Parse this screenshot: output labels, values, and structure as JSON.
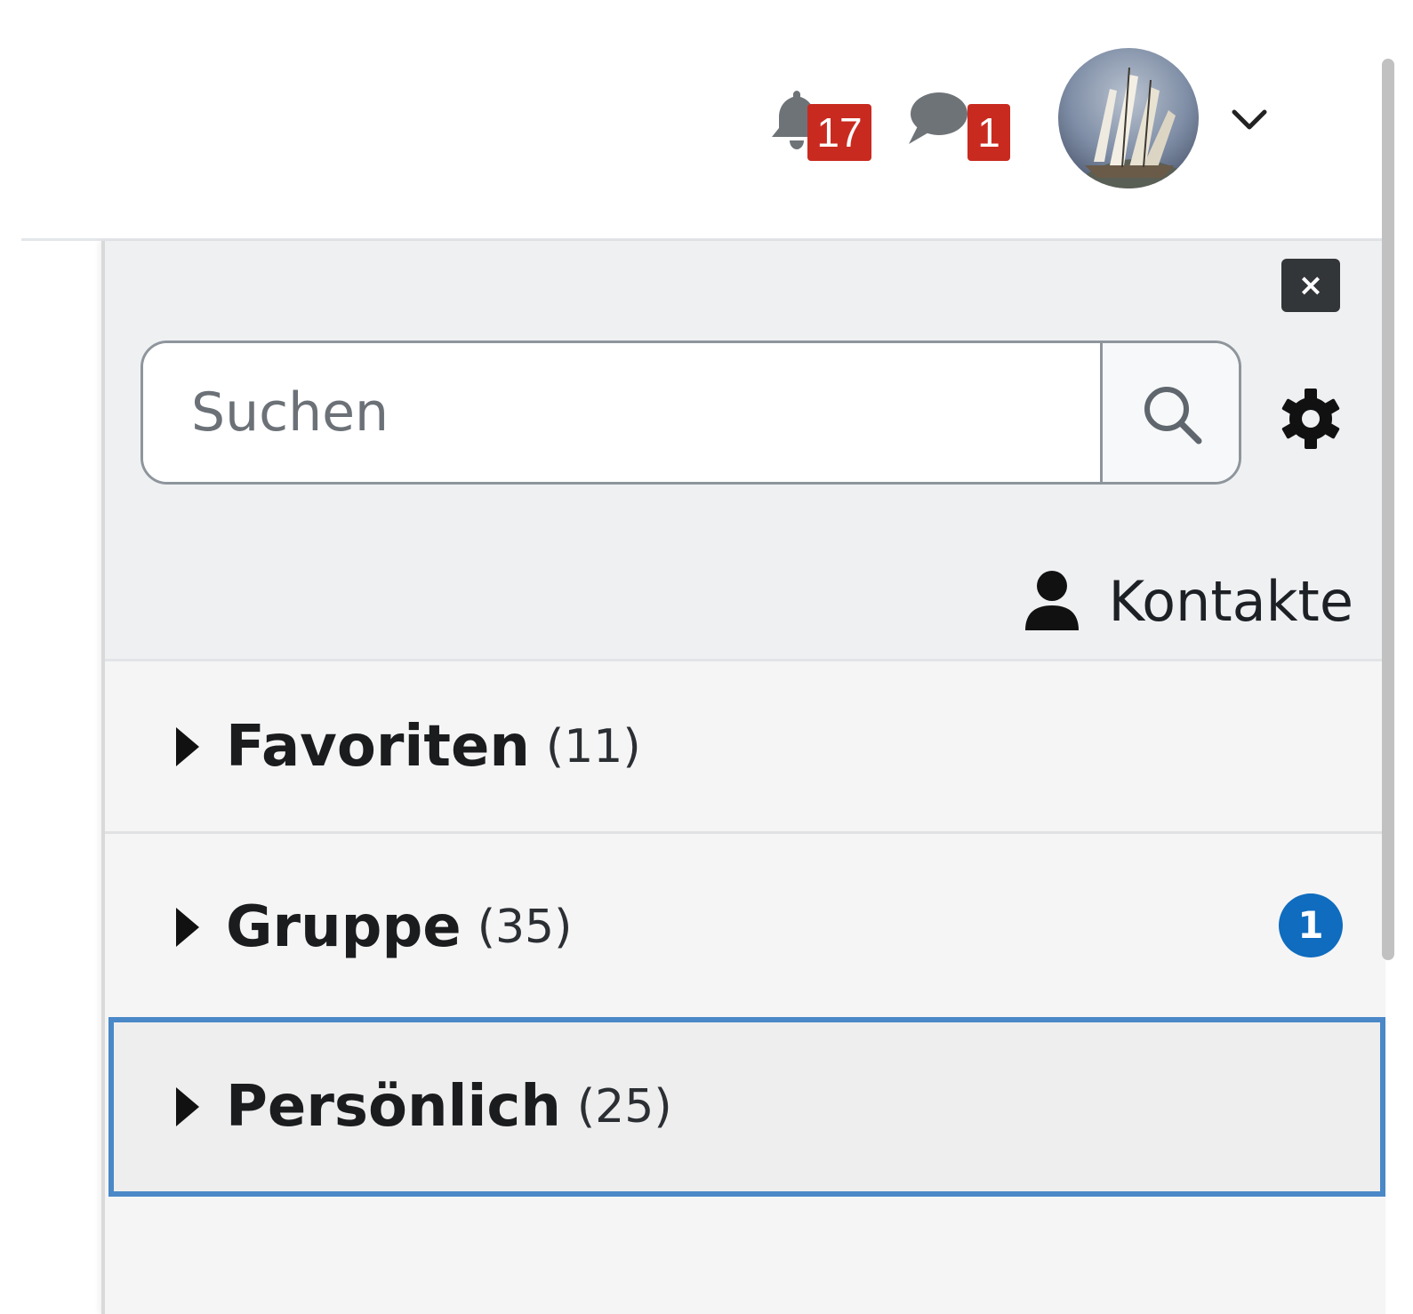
{
  "navbar": {
    "notifications": {
      "icon": "bell-icon",
      "count": "17"
    },
    "messages": {
      "icon": "speech-bubble-icon",
      "count": "1"
    },
    "user_menu": {
      "icon": "chevron-down-icon"
    }
  },
  "drawer": {
    "close_label": "×",
    "search": {
      "placeholder": "Suchen",
      "value": ""
    },
    "contacts_label": "Kontakte",
    "groups": [
      {
        "title": "Favoriten",
        "count": "(11)",
        "unread": ""
      },
      {
        "title": "Gruppe",
        "count": "(35)",
        "unread": "1"
      },
      {
        "title": "Persönlich",
        "count": "(25)",
        "unread": ""
      }
    ]
  },
  "colors": {
    "badge_red": "#c92a1f",
    "unread_blue": "#0f6cbf",
    "focus_outline": "#4a88c8",
    "drawer_header": "#eff0f2",
    "drawer_body": "#f5f5f6"
  }
}
